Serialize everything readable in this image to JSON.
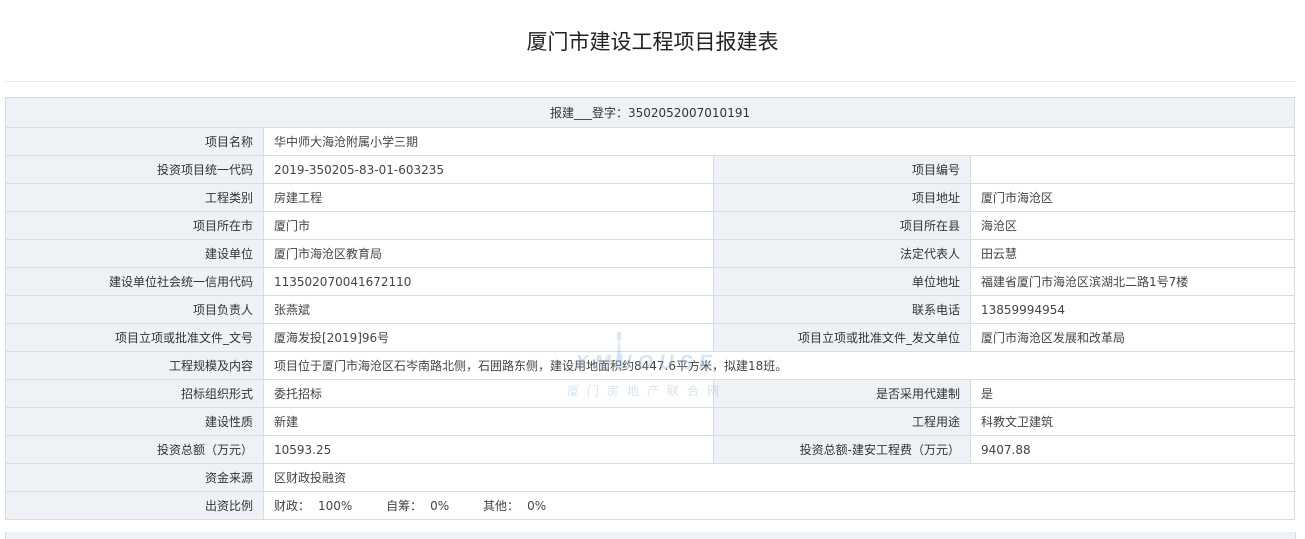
{
  "title": "厦门市建设工程项目报建表",
  "registration": "报建___登字：3502052007010191",
  "rows": {
    "project_name": {
      "label": "项目名称",
      "value": "华中师大海沧附属小学三期"
    },
    "invest_code": {
      "label": "投资项目统一代码",
      "value": "2019-350205-83-01-603235"
    },
    "project_no": {
      "label": "项目编号",
      "value": ""
    },
    "eng_type": {
      "label": "工程类别",
      "value": "房建工程"
    },
    "address": {
      "label": "项目地址",
      "value": "厦门市海沧区"
    },
    "city": {
      "label": "项目所在市",
      "value": "厦门市"
    },
    "county": {
      "label": "项目所在县",
      "value": "海沧区"
    },
    "builder": {
      "label": "建设单位",
      "value": "厦门市海沧区教育局"
    },
    "legal_rep": {
      "label": "法定代表人",
      "value": "田云慧"
    },
    "credit_code": {
      "label": "建设单位社会统一信用代码",
      "value": "113502070041672110"
    },
    "unit_address": {
      "label": "单位地址",
      "value": "福建省厦门市海沧区滨湖北二路1号7楼"
    },
    "manager": {
      "label": "项目负责人",
      "value": "张燕斌"
    },
    "phone": {
      "label": "联系电话",
      "value": "13859994954"
    },
    "approval_no": {
      "label": "项目立项或批准文件_文号",
      "value": "厦海发投[2019]96号"
    },
    "approval_unit": {
      "label": "项目立项或批准文件_发文单位",
      "value": "厦门市海沧区发展和改革局"
    },
    "scale": {
      "label": "工程规模及内容",
      "value": "项目位于厦门市海沧区石岑南路北侧，石囲路东侧，建设用地面积约8447.6平方米，拟建18班。"
    },
    "bidding_form": {
      "label": "招标组织形式",
      "value": "委托招标"
    },
    "agent_build": {
      "label": "是否采用代建制",
      "value": "是"
    },
    "nature": {
      "label": "建设性质",
      "value": "新建"
    },
    "usage": {
      "label": "工程用途",
      "value": "科教文卫建筑"
    },
    "total_invest": {
      "label": "投资总额（万元）",
      "value": "10593.25"
    },
    "install_cost": {
      "label": "投资总额-建安工程费（万元）",
      "value": "9407.88"
    },
    "fund_source": {
      "label": "资金来源",
      "value": "区财政投融资"
    },
    "ratio": {
      "label": "出资比例",
      "fiscal_label": "财政：",
      "fiscal_value": "100%",
      "self_label": "自筹：",
      "self_value": "0%",
      "other_label": "其他：",
      "other_value": "0%"
    }
  },
  "watermark": {
    "brand": "XMHOUSE",
    "sub": "厦门房地产联合网"
  }
}
